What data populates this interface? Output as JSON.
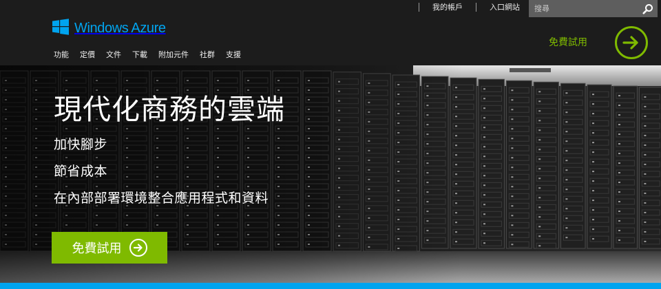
{
  "utility_nav": {
    "account": "我的帳戶",
    "portal": "入口網站"
  },
  "search": {
    "placeholder": "搜尋",
    "icon": "search-icon"
  },
  "logo": {
    "text": "Windows Azure",
    "icon": "windows-flag-icon"
  },
  "main_nav": {
    "items": [
      "功能",
      "定價",
      "文件",
      "下載",
      "附加元件",
      "社群",
      "支援"
    ]
  },
  "header_trial": {
    "label": "免費試用",
    "icon": "arrow-right-circle-icon"
  },
  "hero": {
    "title": "現代化商務的雲端",
    "lines": [
      "加快腳步",
      "節省成本",
      "在內部部署環境整合應用程式和資料"
    ],
    "cta_label": "免費試用",
    "cta_icon": "arrow-right-circle-icon"
  },
  "colors": {
    "azure_blue": "#00a4ef",
    "green": "#7fba00",
    "header_bg": "#1c1c1c",
    "search_bg": "#5e5e5e"
  }
}
